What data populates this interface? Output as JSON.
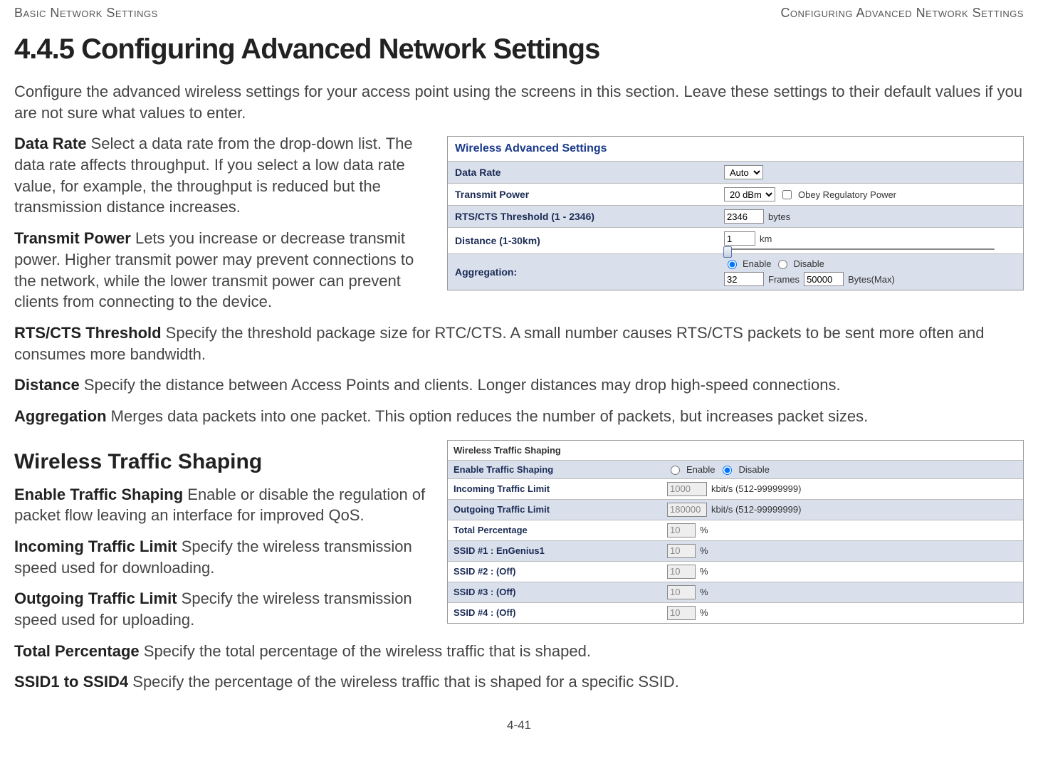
{
  "header": {
    "left": "Basic Network Settings",
    "right": "Configuring Advanced Network Settings"
  },
  "title": "4.4.5 Configuring Advanced Network Settings",
  "intro": "Configure the advanced wireless settings for your access point using the screens in this section. Leave these settings to their default values if you are not sure what values to enter.",
  "defs": {
    "data_rate_term": "Data Rate",
    "data_rate_text": "  Select a data rate from the drop-down list. The data rate affects throughput. If you select a low data rate value, for example, the throughput is reduced but the transmission distance increases.",
    "transmit_power_term": "Transmit Power",
    "transmit_power_text": "  Lets you increase or decrease transmit power. Higher transmit power may prevent connections to the network, while the lower transmit power can prevent clients from connecting to the device.",
    "rts_term": "RTS/CTS Threshold",
    "rts_text": "  Specify the threshold package size for RTC/CTS. A small number causes RTS/CTS packets to be sent more often and consumes more bandwidth.",
    "distance_term": "Distance",
    "distance_text": "  Specify the distance between Access Points and clients. Longer distances may drop high-speed connections.",
    "aggregation_term": "Aggregation",
    "aggregation_text": "  Merges data packets into one packet. This option reduces the number of packets, but increases packet sizes."
  },
  "panel1": {
    "title": "Wireless Advanced Settings",
    "rows": {
      "data_rate": {
        "label": "Data Rate",
        "value": "Auto"
      },
      "transmit_power": {
        "label": "Transmit Power",
        "value": "20 dBm",
        "obey_label": "Obey Regulatory Power"
      },
      "rts": {
        "label": "RTS/CTS Threshold (1 - 2346)",
        "value": "2346",
        "unit": "bytes"
      },
      "distance": {
        "label": "Distance (1-30km)",
        "value": "1",
        "unit": "km"
      },
      "aggregation": {
        "label": "Aggregation:",
        "enable": "Enable",
        "disable": "Disable",
        "frames_val": "32",
        "frames_lbl": "Frames",
        "bytes_val": "50000",
        "bytes_lbl": "Bytes(Max)"
      }
    }
  },
  "sub_heading": "Wireless Traffic Shaping",
  "defs2": {
    "ets_term": "Enable Traffic Shaping",
    "ets_text": "  Enable or disable the regulation of packet flow leaving an interface for improved QoS.",
    "itl_term": "Incoming Traffic Limit",
    "itl_text": "  Specify the wireless transmission speed used for downloading.",
    "otl_term": "Outgoing Traffic Limit",
    "otl_text": "  Specify the wireless transmission speed used for uploading.",
    "tp_term": "Total Percentage",
    "tp_text": "  Specify the total percentage of the wireless traffic that is shaped.",
    "ssid_term": "SSID1 to SSID4",
    "ssid_text": "  Specify the percentage of the wireless traffic that is shaped for a specific SSID."
  },
  "panel2": {
    "title": "Wireless Traffic Shaping",
    "rows": {
      "ets": {
        "label": "Enable Traffic Shaping",
        "enable": "Enable",
        "disable": "Disable"
      },
      "itl": {
        "label": "Incoming Traffic Limit",
        "value": "1000",
        "unit": "kbit/s (512-99999999)"
      },
      "otl": {
        "label": "Outgoing Traffic Limit",
        "value": "180000",
        "unit": "kbit/s (512-99999999)"
      },
      "tp": {
        "label": "Total Percentage",
        "value": "10",
        "unit": "%"
      },
      "s1": {
        "label": "SSID #1 : EnGenius1",
        "value": "10",
        "unit": "%"
      },
      "s2": {
        "label": "SSID #2 : (Off)",
        "value": "10",
        "unit": "%"
      },
      "s3": {
        "label": "SSID #3 : (Off)",
        "value": "10",
        "unit": "%"
      },
      "s4": {
        "label": "SSID #4 : (Off)",
        "value": "10",
        "unit": "%"
      }
    }
  },
  "page_number": "4-41"
}
